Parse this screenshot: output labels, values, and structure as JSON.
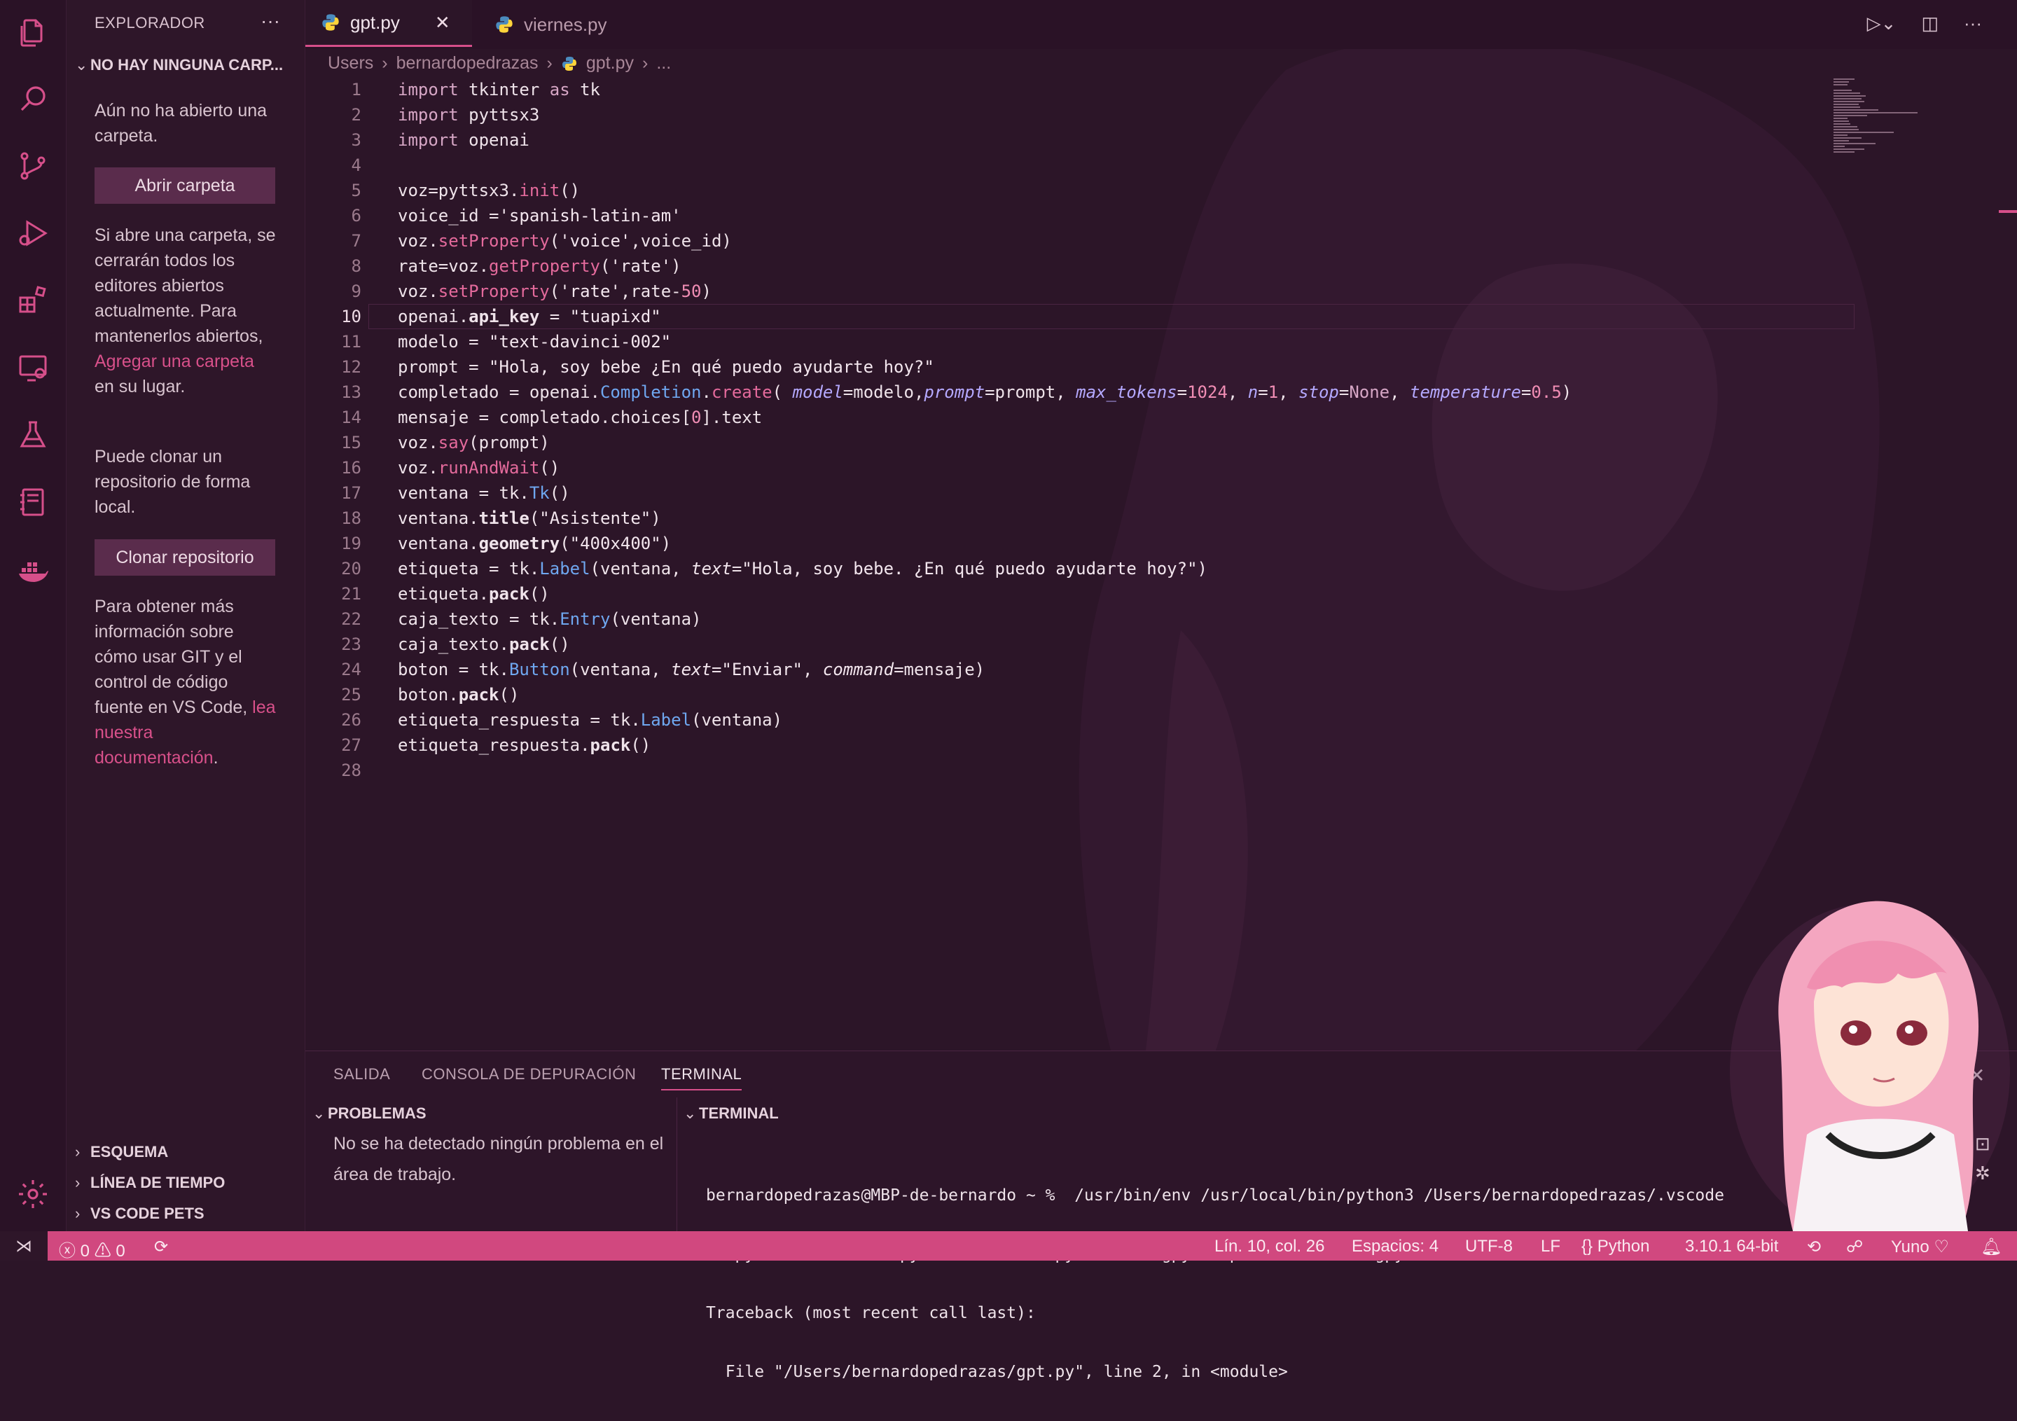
{
  "app": {
    "name": "Visual Studio Code"
  },
  "sidebar": {
    "title": "EXPLORADOR",
    "more": "···",
    "folder_section": "NO HAY NINGUNA CARP...",
    "no_folder_text": "Aún no ha abierto una carpeta.",
    "open_folder_button": "Abrir carpeta",
    "open_info_pre": "Si abre una carpeta, se cerrarán todos los editores abiertos actualmente. Para mantenerlos abiertos, ",
    "open_info_link": "Agregar una carpeta",
    "open_info_post": " en su lugar.",
    "clone_text": "Puede clonar un repositorio de forma local.",
    "clone_button": "Clonar repositorio",
    "git_info_pre": "Para obtener más información sobre cómo usar GIT y el control de código fuente en VS Code, ",
    "git_info_link": "lea nuestra documentación",
    "git_info_post": ".",
    "sections": [
      "ESQUEMA",
      "LÍNEA DE TIEMPO",
      "VS CODE PETS"
    ]
  },
  "tabs": [
    {
      "label": "gpt.py",
      "active": true,
      "icon": "python-icon"
    },
    {
      "label": "viernes.py",
      "active": false,
      "icon": "python-icon"
    }
  ],
  "breadcrumb": [
    "Users",
    "bernardopedrazas",
    "gpt.py",
    "..."
  ],
  "editor": {
    "current_line": 10,
    "lines": [
      "import tkinter as tk",
      "import pyttsx3",
      "import openai",
      "",
      "voz=pyttsx3.init()",
      "voice_id ='spanish-latin-am'",
      "voz.setProperty('voice',voice_id)",
      "rate=voz.getProperty('rate')",
      "voz.setProperty('rate',rate-50)",
      "openai.api_key = \"tuapixd\"",
      "modelo = \"text-davinci-002\"",
      "prompt = \"Hola, soy bebe ¿En qué puedo ayudarte hoy?\"",
      "completado = openai.Completion.create( model=modelo,prompt=prompt, max_tokens=1024, n=1, stop=None, temperature=0.5)",
      "mensaje = completado.choices[0].text",
      "voz.say(prompt)",
      "voz.runAndWait()",
      "ventana = tk.Tk()",
      "ventana.title(\"Asistente\")",
      "ventana.geometry(\"400x400\")",
      "etiqueta = tk.Label(ventana, text=\"Hola, soy bebe. ¿En qué puedo ayudarte hoy?\")",
      "etiqueta.pack()",
      "caja_texto = tk.Entry(ventana)",
      "caja_texto.pack()",
      "boton = tk.Button(ventana, text=\"Enviar\", command=mensaje)",
      "boton.pack()",
      "etiqueta_respuesta = tk.Label(ventana)",
      "etiqueta_respuesta.pack()",
      ""
    ]
  },
  "panel": {
    "tabs": [
      "SALIDA",
      "CONSOLA DE DEPURACIÓN",
      "TERMINAL"
    ],
    "active_tab": "TERMINAL",
    "problems_title": "PROBLEMAS",
    "problems_text": "No se ha detectado ningún problema en el área de trabajo.",
    "terminal_title": "TERMINAL",
    "terminal_lines": [
      "bernardopedrazas@MBP-de-bernardo ~ %  /usr/bin/env /usr/local/bin/python3 /Users/bernardopedrazas/.vscode",
      "on.python-2022.20.1/pythonFiles/lib/python/debugpy/adapter/../../debugpy/launcher 54673 -- /Users/bernard",
      "Traceback (most recent call last):",
      "  File \"/Users/bernardopedrazas/gpt.py\", line 2, in <module>"
    ]
  },
  "status": {
    "errors": "0",
    "warnings": "0",
    "position": "Lín. 10, col. 26",
    "spaces": "Espacios: 4",
    "encoding": "UTF-8",
    "eol": "LF",
    "language": "Python",
    "interpreter": "3.10.1 64-bit",
    "theme": "Yuno"
  },
  "colors": {
    "accent": "#d1487f",
    "background": "#2c1528",
    "sidebar": "#2e1629"
  }
}
